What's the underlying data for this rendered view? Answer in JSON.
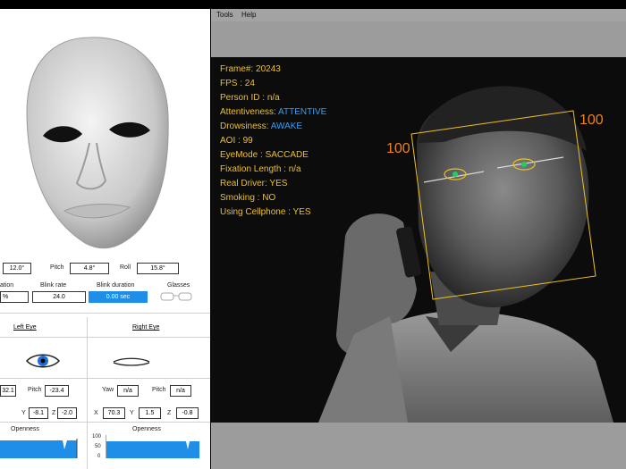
{
  "menu": [
    "Tools",
    "Help"
  ],
  "overlay": {
    "frame_label": "Frame#:",
    "frame_value": "20243",
    "fps_label": "FPS :",
    "fps_value": "24",
    "person_label": "Person ID :",
    "person_value": "n/a",
    "attentiveness_label": "Attentiveness:",
    "attentiveness_value": "ATTENTIVE",
    "drowsiness_label": "Drowsiness:",
    "drowsiness_value": "AWAKE",
    "aoi_label": "AOI :",
    "aoi_value": "99",
    "eyemode_label": "EyeMode :",
    "eyemode_value": "SACCADE",
    "fixation_label": "Fixation Length :",
    "fixation_value": "n/a",
    "real_driver_label": "Real Driver:",
    "real_driver_value": "YES",
    "smoking_label": "Smoking :",
    "smoking_value": "NO",
    "cellphone_label": "Using Cellphone :",
    "cellphone_value": "YES",
    "box_left_label": "100",
    "box_right_label": "100",
    "accent_yellow": "#f0c020",
    "accent_blue": "#2ba0ff"
  },
  "head": {
    "yaw_value": "12.0°",
    "pitch_label": "Pitch",
    "pitch_value": "4.8°",
    "roll_label": "Roll",
    "roll_value": "15.8°"
  },
  "stats": {
    "duration_label": "ation",
    "duration_value": "%",
    "blink_rate_label": "Blink rate",
    "blink_rate_value": "24.0",
    "blink_duration_label": "Blink duration",
    "blink_duration_value": "0.00 sec",
    "glasses_label": "Glasses"
  },
  "left_eye": {
    "title": "Left  Eye",
    "yaw_value": "32.1",
    "pitch_label": "Pitch",
    "pitch_value": "-23.4",
    "y_label": "Y",
    "y_value": "-8.1",
    "z_label": "Z",
    "z_value": "-2.0",
    "openness_label": "Openness"
  },
  "right_eye": {
    "title": "Right  Eye",
    "yaw_label": "Yaw",
    "yaw_value": "n/a",
    "pitch_label": "Pitch",
    "pitch_value": "n/a",
    "x_label": "X",
    "x_value": "70.3",
    "y_label": "Y",
    "y_value": "1.5",
    "z_label": "Z",
    "z_value": "-0.8",
    "openness_label": "Openness",
    "axis_ticks": [
      "100",
      "50",
      "0"
    ]
  },
  "colors": {
    "blue_fill": "#1e8ee8"
  }
}
